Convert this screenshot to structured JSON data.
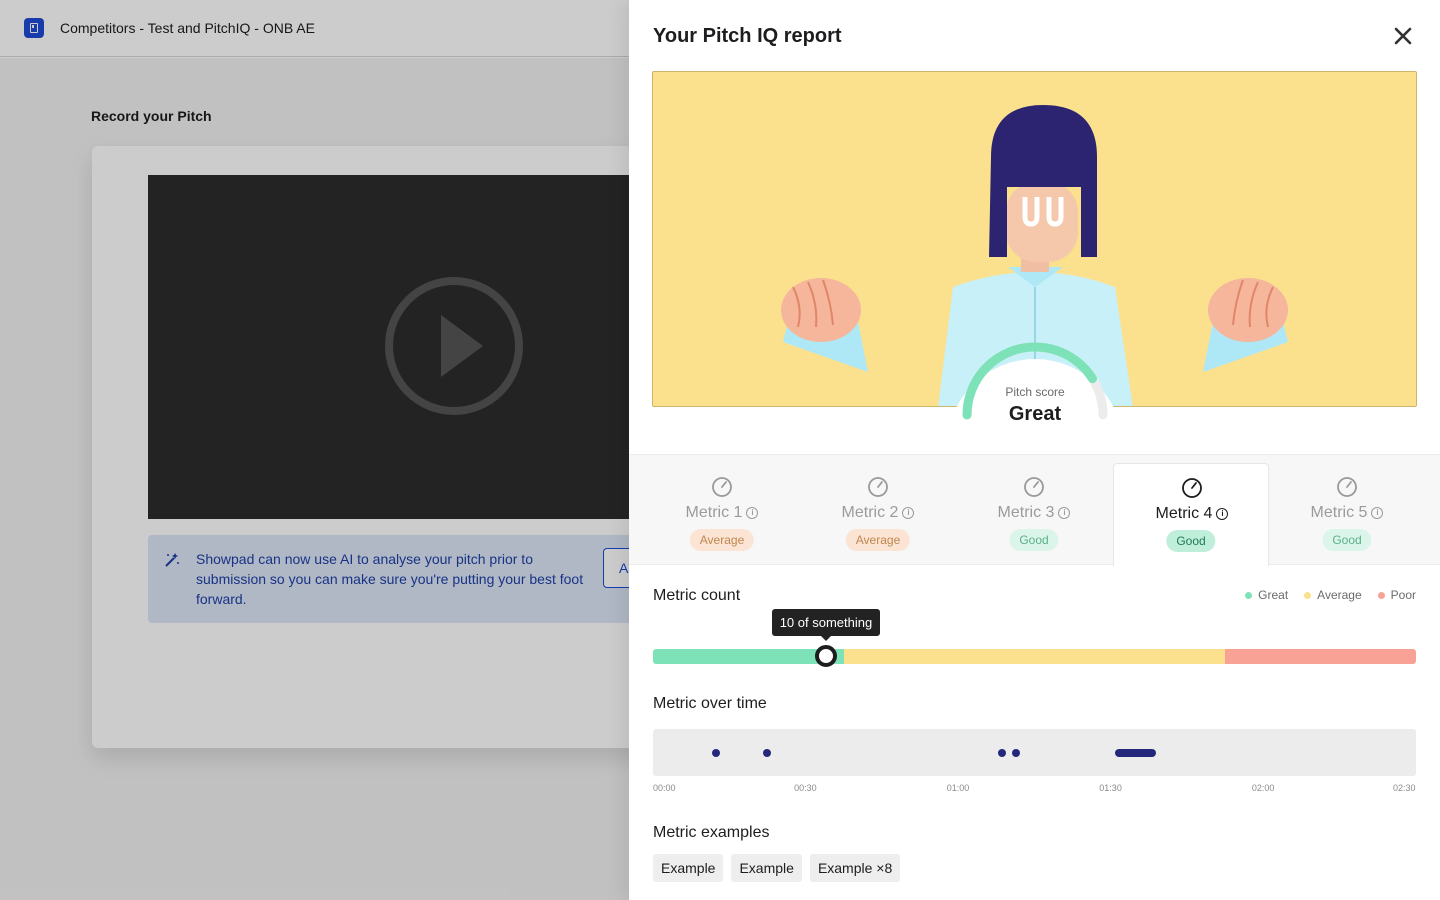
{
  "topbar": {
    "title": "Competitors - Test and PitchIQ - ONB AE"
  },
  "page": {
    "heading": "Record your Pitch",
    "ai_banner": {
      "message": "Showpad can now use AI to analyse your pitch prior to submission so you can make sure you're putting your best foot forward.",
      "button_label": "A"
    }
  },
  "drawer": {
    "title": "Your Pitch IQ report",
    "pitch_score": {
      "label": "Pitch score",
      "value": "Great",
      "dial_level": 0.82
    },
    "metrics": [
      {
        "name": "Metric 1",
        "status": "Average",
        "level": "average",
        "active": false
      },
      {
        "name": "Metric 2",
        "status": "Average",
        "level": "average",
        "active": false
      },
      {
        "name": "Metric 3",
        "status": "Good",
        "level": "good",
        "active": false
      },
      {
        "name": "Metric 4",
        "status": "Good",
        "level": "good",
        "active": true
      },
      {
        "name": "Metric 5",
        "status": "Good",
        "level": "good",
        "active": false
      }
    ],
    "metric_count": {
      "title": "Metric count",
      "legend": [
        {
          "label": "Great",
          "color": "#7ee2b8"
        },
        {
          "label": "Average",
          "color": "#fbe18e"
        },
        {
          "label": "Poor",
          "color": "#f8a296"
        }
      ],
      "segments": [
        0.25,
        0.5,
        0.25
      ],
      "marker_fraction": 0.227,
      "tooltip": "10 of something"
    },
    "metric_over_time": {
      "title": "Metric over time",
      "duration_seconds": 150,
      "ticks": [
        "00:00",
        "00:30",
        "01:00",
        "01:30",
        "02:00",
        "02:30"
      ],
      "events": [
        {
          "start": 7,
          "end": 7
        },
        {
          "start": 18,
          "end": 18
        },
        {
          "start": 68,
          "end": 68
        },
        {
          "start": 71,
          "end": 71
        },
        {
          "start": 93,
          "end": 100
        }
      ]
    },
    "metric_examples": {
      "title": "Metric examples",
      "chips": [
        "Example",
        "Example",
        "Example ×8"
      ]
    }
  }
}
